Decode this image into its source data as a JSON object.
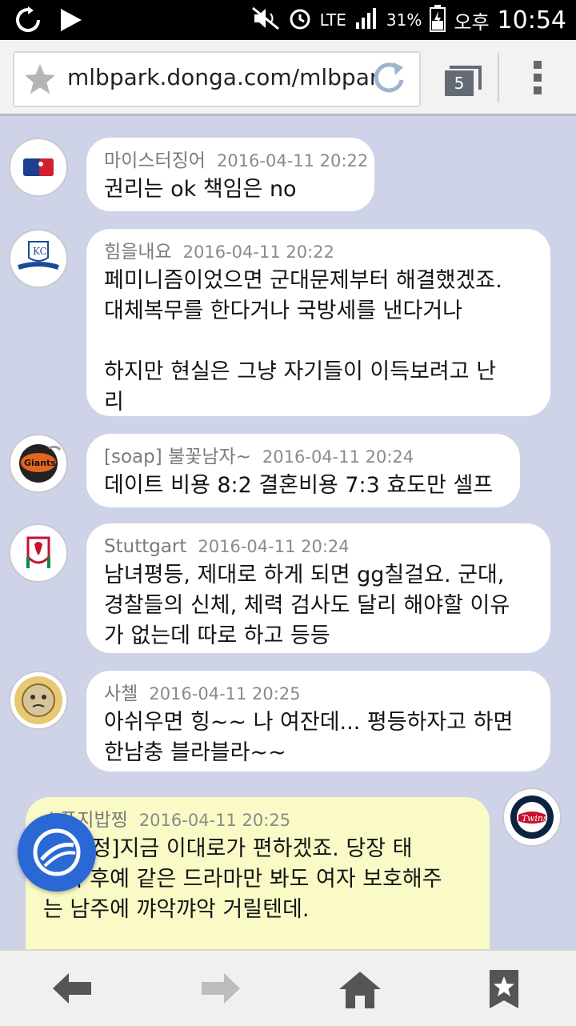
{
  "status_bar": {
    "network": "LTE",
    "battery": "31%",
    "ampm": "오후",
    "time": "10:54"
  },
  "browser": {
    "url": "mlbpark.donga.com/mlbpark/",
    "tab_count": "5"
  },
  "comments": [
    {
      "nick": "마이스터징어",
      "date": "2016-04-11 20:22",
      "text": "권리는 ok 책임은 no"
    },
    {
      "nick": "힘을내요",
      "date": "2016-04-11 20:22",
      "text": "페미니즘이었으면 군대문제부터 해결했겠죠.\n대체복무를 한다거나 국방세를 낸다거나\n\n하지만 현실은 그냥 자기들이 이득보려고 난\n리"
    },
    {
      "nick": "[soap] 불꽃남자~",
      "date": "2016-04-11 20:24",
      "text": "데이트 비용 8:2 결혼비용 7:3 효도만 셀프"
    },
    {
      "nick": "Stuttgart",
      "date": "2016-04-11 20:24",
      "text": "남녀평등, 제대로 하게 되면 gg칠걸요. 군대,\n경찰들의 신체, 체력 검사도 달리 해야할 이유\n가 없는데 따로 하고 등등"
    },
    {
      "nick": "사첼",
      "date": "2016-04-11 20:25",
      "text": "아쉬우면 힝~~ 나 여잔데... 평등하자고 하면\n한남충 블라블라~~"
    },
    {
      "nick": "스폰지밥찡",
      "date": "2016-04-11 20:25",
      "text": "[글수정]지금 이대로가 편하겠죠. 당장 태\n양의 후예 같은 드라마만 봐도 여자 보호해주\n는 남주에 꺄악꺄악 거릴텐데."
    }
  ],
  "colors": {
    "page_bg": "#ced3e8",
    "own_bubble": "#fafac7",
    "fab": "#2a68d6"
  }
}
